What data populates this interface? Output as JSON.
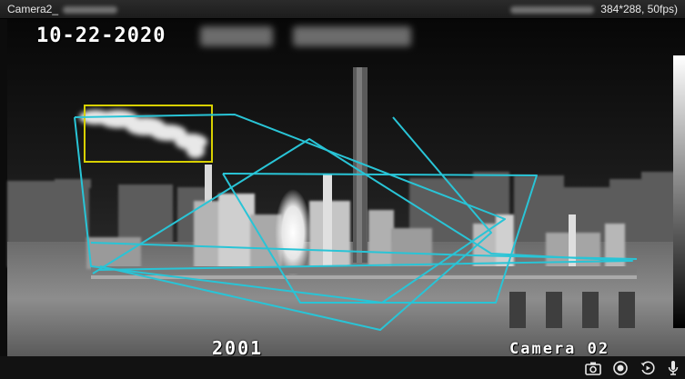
{
  "window": {
    "camera_name": "Camera2_",
    "resolution_info": "384*288, 50fps)"
  },
  "osd": {
    "date": "10-22-2020",
    "code": "2001",
    "camera_label": "Camera 02"
  },
  "colors": {
    "detection_box": "#d8d000",
    "zone_polygons": "#29c4d6"
  },
  "toolbar": {
    "icons": [
      "camera-icon",
      "record-icon",
      "playback-icon",
      "microphone-icon"
    ]
  }
}
